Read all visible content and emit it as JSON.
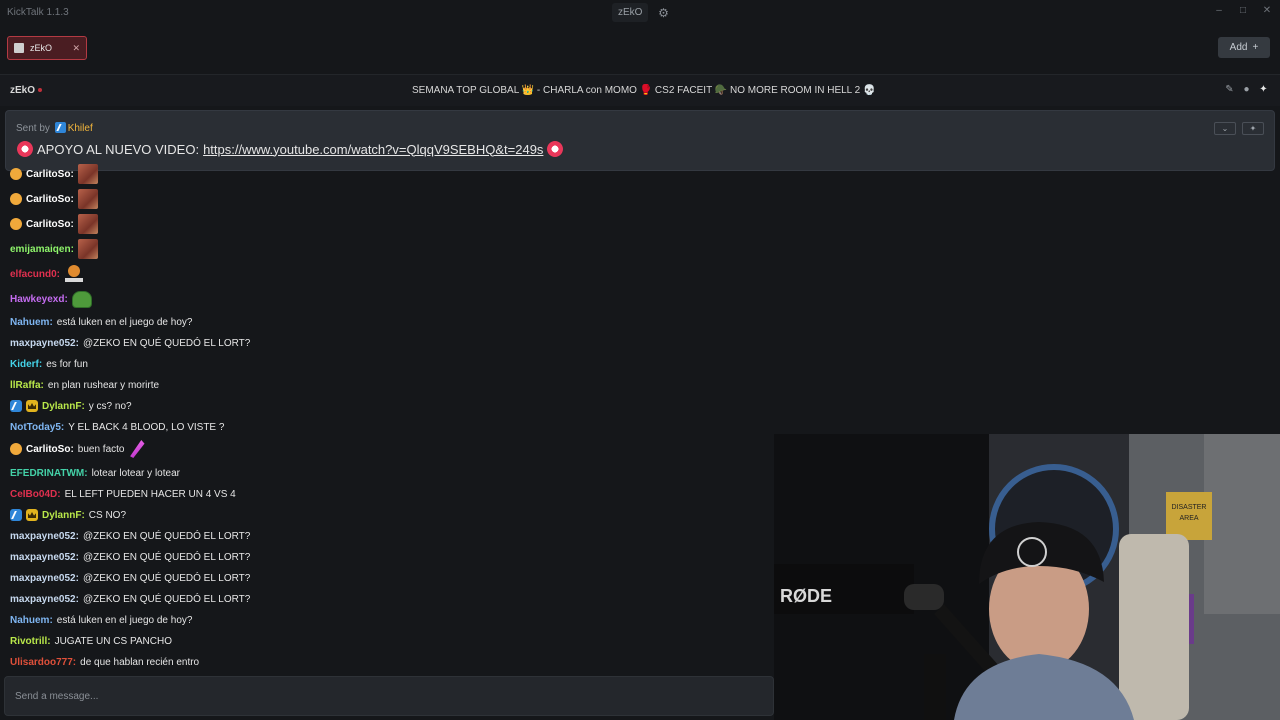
{
  "app": {
    "title": "KickTalk 1.1.3",
    "window_label": "zEkO"
  },
  "tabs": [
    {
      "label": "zEkO"
    }
  ],
  "add_button": {
    "label": "Add"
  },
  "channel": {
    "name": "zEkO",
    "stream_title": "SEMANA TOP GLOBAL 👑 - CHARLA con MOMO 🥊 CS2 FACEIT 🪖 NO MORE ROOM IN HELL 2 💀"
  },
  "pinned": {
    "sent_by_label": "Sent by",
    "user": "Khilef",
    "message_text": "APOYO AL NUEVO VIDEO:",
    "link": "https://www.youtube.com/watch?v=QlqqV9SEBHQ&t=249s"
  },
  "messages": [
    {
      "user": "CarlitoSo:",
      "color": "#ffffff",
      "badges": [
        "gift"
      ],
      "text": "",
      "emote": "box"
    },
    {
      "user": "CarlitoSo:",
      "color": "#ffffff",
      "badges": [
        "gift"
      ],
      "text": "",
      "emote": "box"
    },
    {
      "user": "CarlitoSo:",
      "color": "#ffffff",
      "badges": [
        "gift"
      ],
      "text": "",
      "emote": "box"
    },
    {
      "user": "emijamaiqen:",
      "color": "#8ef56b",
      "badges": [],
      "text": "",
      "emote": "box"
    },
    {
      "user": "elfacund0:",
      "color": "#e0304f",
      "badges": [],
      "text": "",
      "emote": "stonks"
    },
    {
      "user": "Hawkeyexd:",
      "color": "#c46cf0",
      "badges": [],
      "text": "",
      "emote": "pepe"
    },
    {
      "user": "Nahuem:",
      "color": "#7fb6f2",
      "badges": [],
      "text": "está luken en el juego de hoy?",
      "emote": ""
    },
    {
      "user": "maxpayne052:",
      "color": "#c6d8ee",
      "badges": [],
      "text": "@ZEKO EN QUÉ QUEDÓ EL LORT?",
      "emote": ""
    },
    {
      "user": "Kiderf:",
      "color": "#44d2e8",
      "badges": [],
      "text": "es for fun",
      "emote": ""
    },
    {
      "user": "llRaffa:",
      "color": "#b9e84a",
      "badges": [],
      "text": "en plan rushear y morirte",
      "emote": ""
    },
    {
      "user": "DylannF:",
      "color": "#b9e84a",
      "badges": [
        "vip",
        "crown"
      ],
      "text": "y cs? no?",
      "emote": ""
    },
    {
      "user": "NotToday5:",
      "color": "#7fb6f2",
      "badges": [],
      "text": "Y EL BACK 4 BLOOD, LO VISTE ?",
      "emote": ""
    },
    {
      "user": "CarlitoSo:",
      "color": "#ffffff",
      "badges": [
        "gift"
      ],
      "text": "buen facto",
      "emote": "feather"
    },
    {
      "user": "EFEDRINATWM:",
      "color": "#44d2a8",
      "badges": [],
      "text": "lotear lotear y lotear",
      "emote": ""
    },
    {
      "user": "CeIBo04D:",
      "color": "#e0304f",
      "badges": [],
      "text": "EL LEFT PUEDEN HACER UN 4 VS 4",
      "emote": ""
    },
    {
      "user": "DylannF:",
      "color": "#b9e84a",
      "badges": [
        "vip",
        "crown"
      ],
      "text": "CS NO?",
      "emote": ""
    },
    {
      "user": "maxpayne052:",
      "color": "#c6d8ee",
      "badges": [],
      "text": "@ZEKO EN QUÉ QUEDÓ EL LORT?",
      "emote": ""
    },
    {
      "user": "maxpayne052:",
      "color": "#c6d8ee",
      "badges": [],
      "text": "@ZEKO EN QUÉ QUEDÓ EL LORT?",
      "emote": ""
    },
    {
      "user": "maxpayne052:",
      "color": "#c6d8ee",
      "badges": [],
      "text": "@ZEKO EN QUÉ QUEDÓ EL LORT?",
      "emote": ""
    },
    {
      "user": "maxpayne052:",
      "color": "#c6d8ee",
      "badges": [],
      "text": "@ZEKO EN QUÉ QUEDÓ EL LORT?",
      "emote": ""
    },
    {
      "user": "Nahuem:",
      "color": "#7fb6f2",
      "badges": [],
      "text": "está luken en el juego de hoy?",
      "emote": ""
    },
    {
      "user": "Rivotrill:",
      "color": "#b9e84a",
      "badges": [],
      "text": "JUGATE UN CS PANCHO",
      "emote": ""
    },
    {
      "user": "Ulisardoo777:",
      "color": "#e0503a",
      "badges": [],
      "text": "de que hablan recién entro",
      "emote": ""
    }
  ],
  "input": {
    "placeholder": "Send a message..."
  },
  "webcam": {
    "brand_text": "RØDE",
    "poster_text": "DISASTER AREA"
  }
}
